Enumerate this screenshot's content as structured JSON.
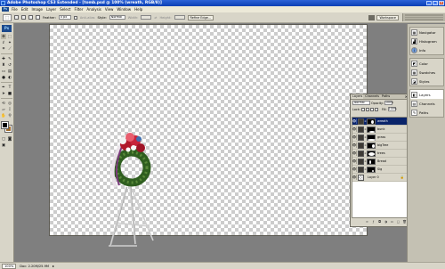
{
  "titlebar": {
    "title": "Adobe Photoshop CS3 Extended - [tomb.psd @ 100% (wreath, RGB/8)]"
  },
  "menu": {
    "logo": "Ps",
    "items": [
      "File",
      "Edit",
      "Image",
      "Layer",
      "Select",
      "Filter",
      "Analysis",
      "View",
      "Window",
      "Help"
    ]
  },
  "options": {
    "feather_label": "Feather:",
    "feather_value": "0 px",
    "antialias_label": "Anti-alias",
    "style_label": "Style:",
    "style_value": "Normal",
    "width_label": "Width:",
    "height_label": "Height:",
    "refine_label": "Refine Edge...",
    "workspace_label": "Workspace"
  },
  "toolbox": {
    "badge": "Ps"
  },
  "status": {
    "zoom": "100%",
    "doc": "Doc: 2.20M/25.9M"
  },
  "layers_panel": {
    "tabs": [
      "Layers",
      "Channels",
      "Paths"
    ],
    "blend_mode": "Normal",
    "opacity_label": "Opacity:",
    "opacity_value": "100%",
    "lock_label": "Lock:",
    "fill_label": "Fill:",
    "fill_value": "100%",
    "layers": [
      {
        "name": "wreath",
        "selected": true
      },
      {
        "name": "bunk",
        "selected": false
      },
      {
        "name": "grass",
        "selected": false
      },
      {
        "name": "bigTree",
        "selected": false
      },
      {
        "name": "trees",
        "selected": false
      },
      {
        "name": "Bread",
        "selected": false
      },
      {
        "name": "Sig",
        "selected": false
      },
      {
        "name": "Layer 0",
        "selected": false
      }
    ]
  },
  "dock": {
    "group1": [
      "Navigator",
      "Histogram",
      "Info"
    ],
    "group2": [
      "Color",
      "Swatches",
      "Styles"
    ],
    "group3": [
      "Layers",
      "Channels",
      "Paths"
    ],
    "active_item": "Layers"
  },
  "colors": {
    "accent": "#0a246a",
    "foreground": "#000000",
    "background": "#a06a28"
  }
}
